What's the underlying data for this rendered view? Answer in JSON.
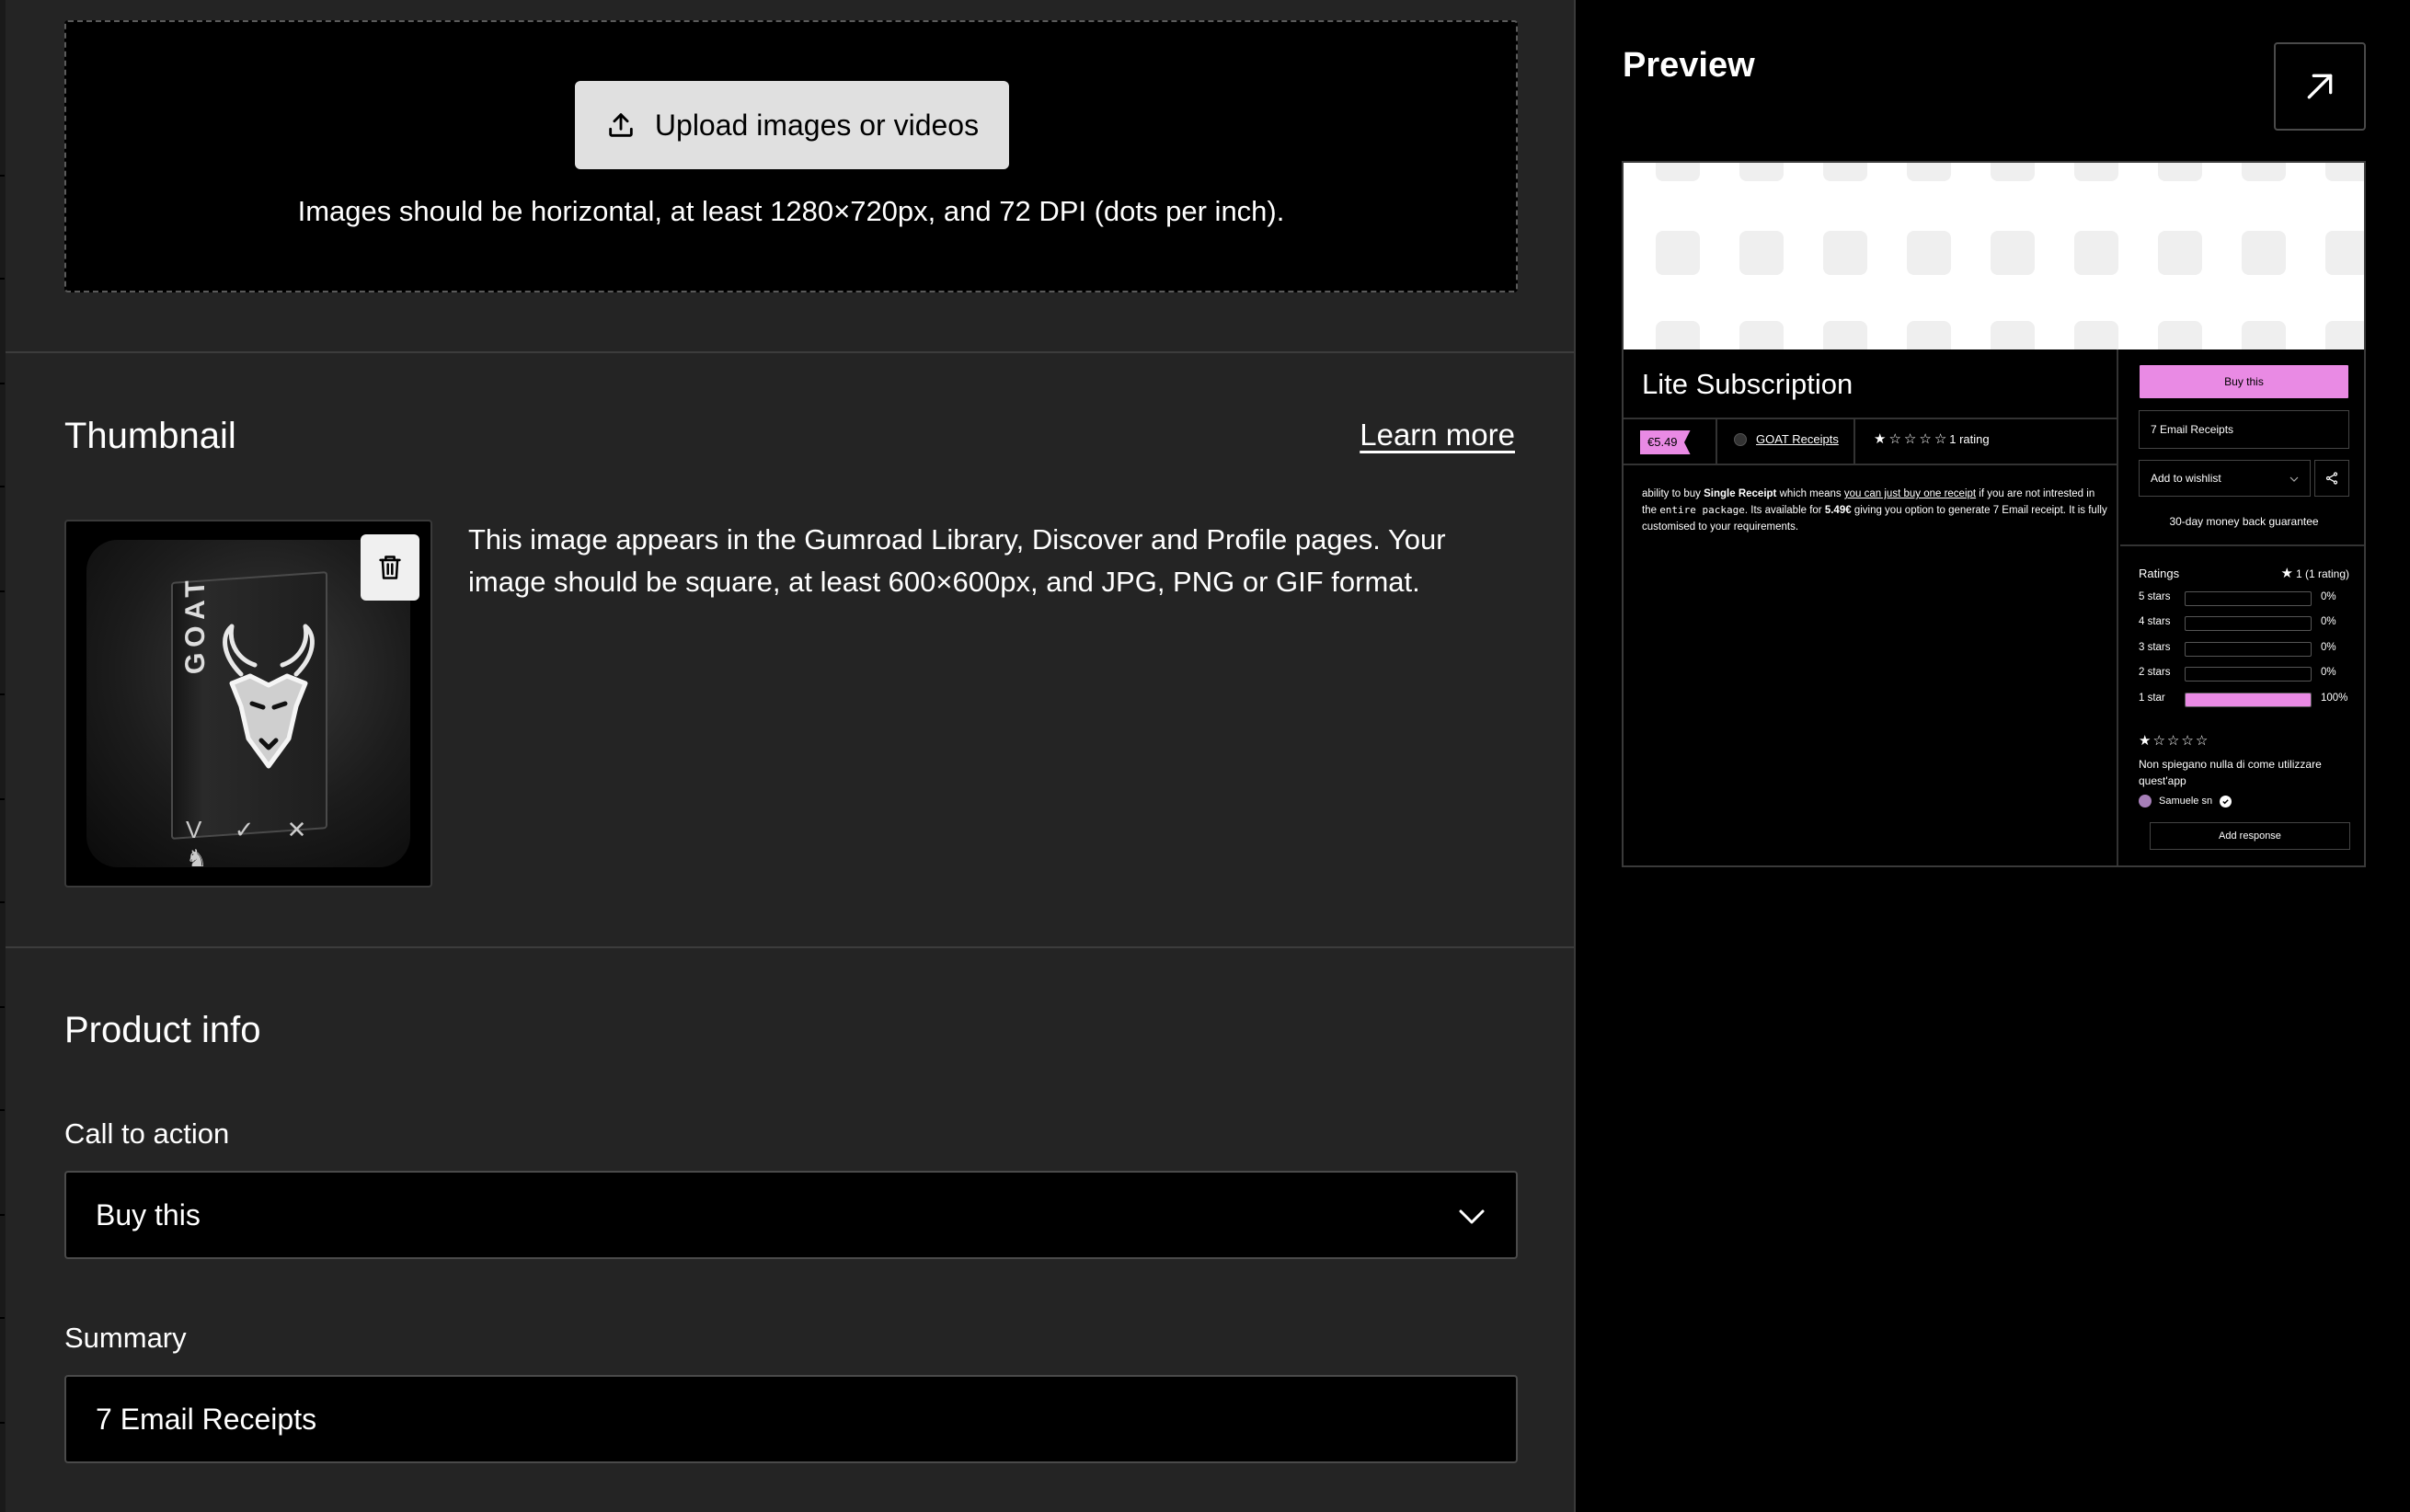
{
  "upload": {
    "button_label": "Upload images or videos",
    "hint": "Images should be horizontal, at least 1280×720px, and 72 DPI (dots per inch)."
  },
  "thumbnail": {
    "title": "Thumbnail",
    "learn_more": "Learn more",
    "description": "This image appears in the Gumroad Library, Discover and Profile pages. Your image should be square, at least 600×600px, and JPG, PNG or GIF format.",
    "image_text": "GOAT",
    "image_logos": "V ✓ ✕ ♞"
  },
  "product_info": {
    "title": "Product info",
    "cta_label": "Call to action",
    "cta_value": "Buy this",
    "summary_label": "Summary",
    "summary_value": "7 Email Receipts"
  },
  "preview": {
    "title": "Preview",
    "product_title": "Lite Subscription",
    "price": "€5.49",
    "creator": "GOAT Receipts",
    "rating_text": "1 rating",
    "description": {
      "p1": "ability to buy ",
      "bold1": "Single Receipt",
      "p2": " which means ",
      "link": "you can just buy one receipt",
      "p3": " if you are not intrested in the ",
      "code": "entire package",
      "p4": ". Its available for ",
      "bold2": "5.49€",
      "p5": " giving you option to generate 7 Email receipt. It is fully customised to your requirements."
    },
    "buy_button": "Buy this",
    "summary": "7 Email Receipts",
    "wishlist": "Add to wishlist",
    "guarantee": "30-day money back guarantee",
    "ratings_title": "Ratings",
    "ratings_summary": "1 (1 rating)",
    "rating_rows": [
      {
        "label": "5 stars",
        "pct": "0%",
        "fill": 0
      },
      {
        "label": "4 stars",
        "pct": "0%",
        "fill": 0
      },
      {
        "label": "3 stars",
        "pct": "0%",
        "fill": 0
      },
      {
        "label": "2 stars",
        "pct": "0%",
        "fill": 0
      },
      {
        "label": "1 star",
        "pct": "100%",
        "fill": 1
      }
    ],
    "review_text": "Non spiegano nulla di come utilizzare quest'app",
    "reviewer": "Samuele sn",
    "add_response": "Add response"
  },
  "colors": {
    "accent_pink": "#e98ae4",
    "panel_bg": "#242424",
    "page_bg": "#000000"
  }
}
